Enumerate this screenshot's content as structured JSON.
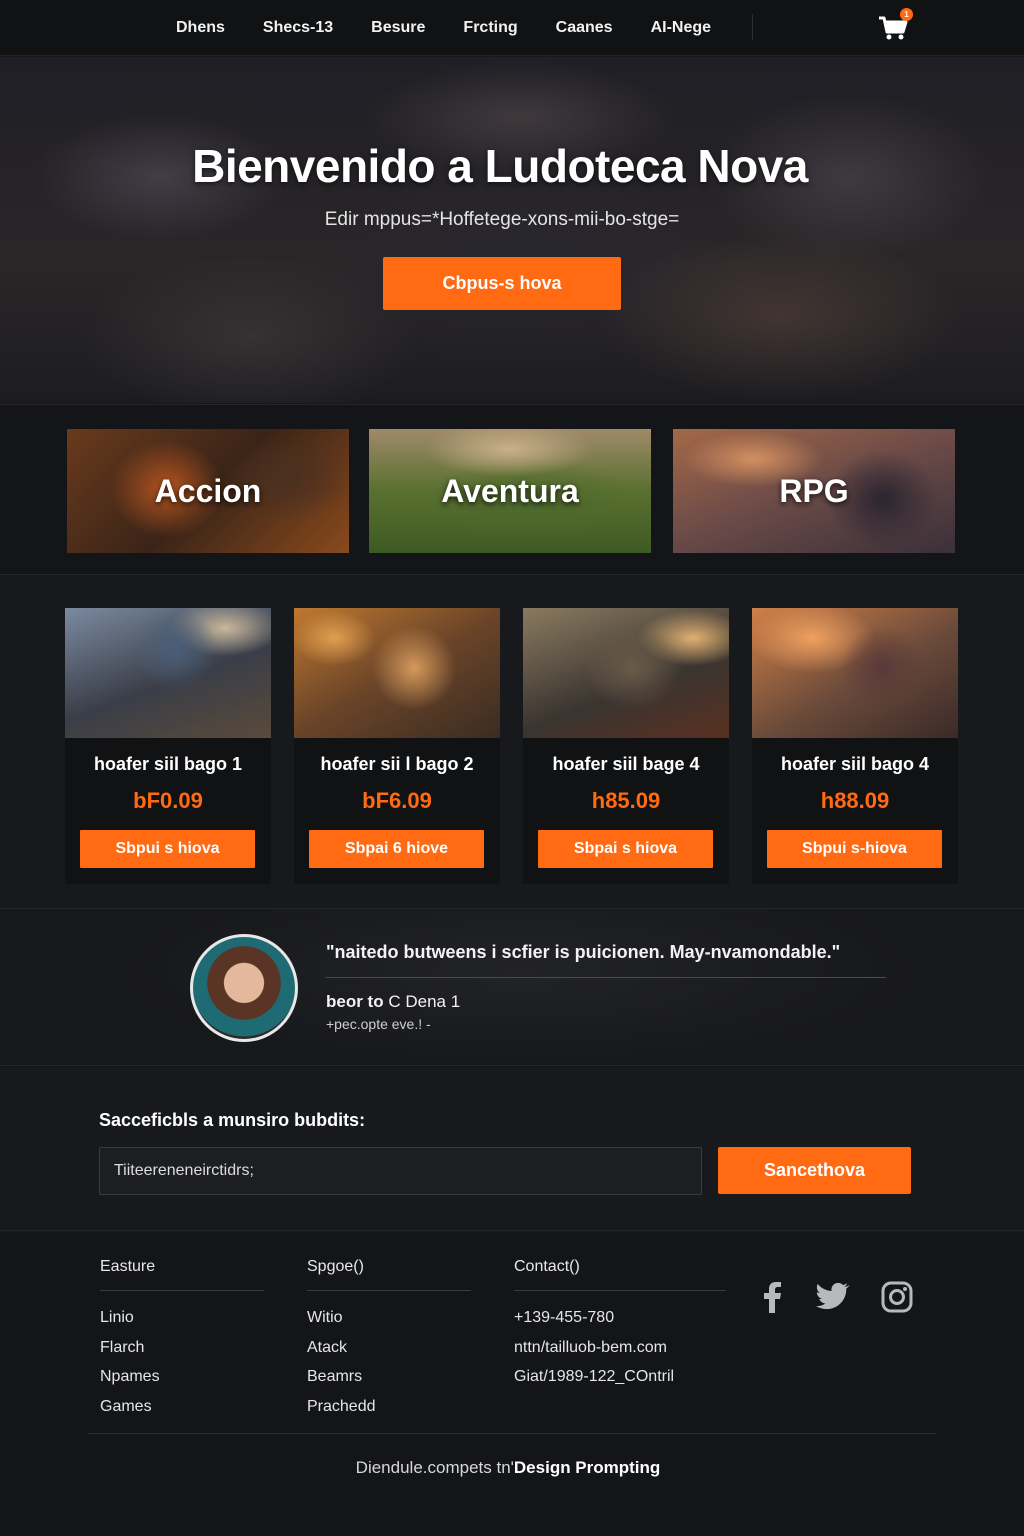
{
  "nav": {
    "links": [
      "Dhens",
      "Shecs-13",
      "Besure",
      "Frcting",
      "Caanes",
      "AI-Nege"
    ],
    "cart_count": "1"
  },
  "hero": {
    "title": "Bienvenido a Ludoteca Nova",
    "subtitle": "Edir mppus=*Hoffetege-xons-mii-bo-stge=",
    "cta": "Cbpus-s hova"
  },
  "categories": [
    "Accion",
    "Aventura",
    "RPG"
  ],
  "products": [
    {
      "title": "hoafer siil bago 1",
      "price": "bF0.09",
      "cta": "Sbpui s hiova"
    },
    {
      "title": "hoafer sii l bago 2",
      "price": "bF6.09",
      "cta": "Sbpai 6 hiove"
    },
    {
      "title": "hoafer siil bage 4",
      "price": "h85.09",
      "cta": "Sbpai s hiova"
    },
    {
      "title": "hoafer siil bago 4",
      "price": "h88.09",
      "cta": "Sbpui s-hiova"
    }
  ],
  "testimonial": {
    "quote": "\"naitedo butweens i scfier is puicionen. May-nvamondable.\"",
    "author_name": "beor to",
    "author_rest": " C Dena 1",
    "author_role": "+pec.opte eve.! -"
  },
  "newsletter": {
    "label": "Sacceficbls a munsiro bubdits:",
    "input_value": "Tiiteereneneirctidrs;",
    "button": "Sancethova"
  },
  "footer": {
    "col1": {
      "heading": "Easture",
      "items": [
        "Linio",
        "Flarch",
        "Npames",
        "Games"
      ]
    },
    "col2": {
      "heading": "Spgoe()",
      "items": [
        "Witio",
        "Atack",
        "Beamrs",
        "Prachedd"
      ]
    },
    "col3": {
      "heading": "Contact()",
      "items": [
        "+139-455-780",
        "nttn/tailluob-bem.com",
        "Giat/1989-122_COntril"
      ]
    },
    "credit_pre": "Diendule.compets tn'",
    "credit_brand": "Design Prompting"
  },
  "colors": {
    "accent": "#ff6a13",
    "background": "#17181b"
  }
}
